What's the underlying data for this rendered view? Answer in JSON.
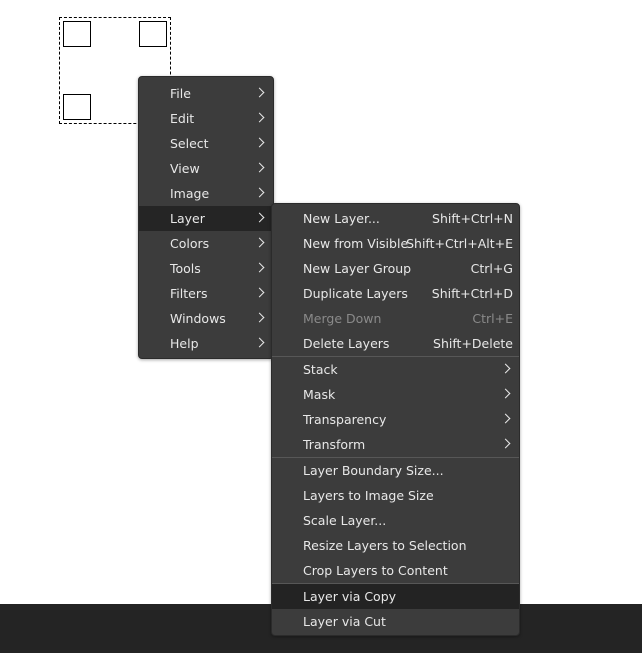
{
  "main_menu": {
    "items": [
      {
        "label": "File"
      },
      {
        "label": "Edit"
      },
      {
        "label": "Select"
      },
      {
        "label": "View"
      },
      {
        "label": "Image"
      },
      {
        "label": "Layer"
      },
      {
        "label": "Colors"
      },
      {
        "label": "Tools"
      },
      {
        "label": "Filters"
      },
      {
        "label": "Windows"
      },
      {
        "label": "Help"
      }
    ],
    "active": "Layer"
  },
  "layer_menu": {
    "group1": [
      {
        "label": "New Layer...",
        "shortcut": "Shift+Ctrl+N"
      },
      {
        "label": "New from Visible",
        "shortcut": "Shift+Ctrl+Alt+E"
      },
      {
        "label": "New Layer Group",
        "shortcut": "Ctrl+G"
      },
      {
        "label": "Duplicate Layers",
        "shortcut": "Shift+Ctrl+D"
      },
      {
        "label": "Merge Down",
        "shortcut": "Ctrl+E",
        "disabled": true
      },
      {
        "label": "Delete Layers",
        "shortcut": "Shift+Delete"
      }
    ],
    "group2": [
      {
        "label": "Stack"
      },
      {
        "label": "Mask"
      },
      {
        "label": "Transparency"
      },
      {
        "label": "Transform"
      }
    ],
    "group3": [
      {
        "label": "Layer Boundary Size..."
      },
      {
        "label": "Layers to Image Size"
      },
      {
        "label": "Scale Layer..."
      },
      {
        "label": "Resize Layers to Selection"
      },
      {
        "label": "Crop Layers to Content"
      }
    ],
    "group4": [
      {
        "label": "Layer via Copy",
        "highlighted": true
      },
      {
        "label": "Layer via Cut"
      }
    ]
  }
}
